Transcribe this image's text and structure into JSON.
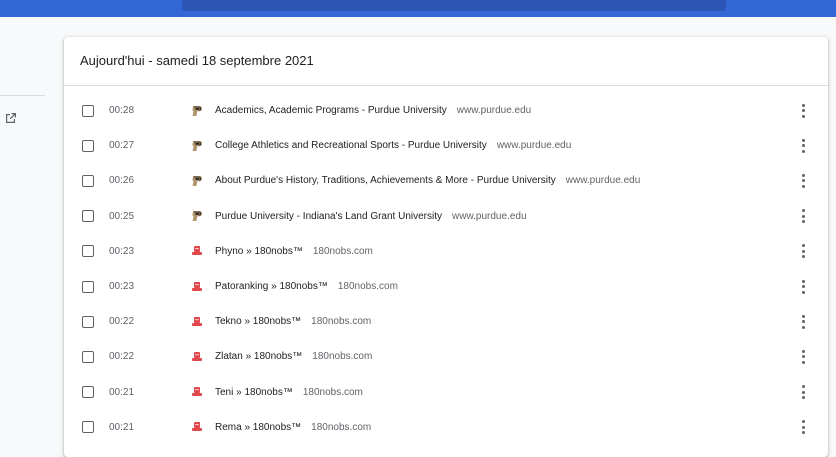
{
  "header": {
    "search_placeholder": ""
  },
  "history": {
    "date_heading": "Aujourd'hui - samedi 18 septembre 2021",
    "entries": [
      {
        "time": "00:28",
        "title": "Academics, Academic Programs - Purdue University",
        "domain": "www.purdue.edu",
        "favicon": "purdue-p-icon"
      },
      {
        "time": "00:27",
        "title": "College Athletics and Recreational Sports - Purdue University",
        "domain": "www.purdue.edu",
        "favicon": "purdue-p-icon"
      },
      {
        "time": "00:26",
        "title": "About Purdue's History, Traditions, Achievements & More - Purdue University",
        "domain": "www.purdue.edu",
        "favicon": "purdue-p-icon"
      },
      {
        "time": "00:25",
        "title": "Purdue University - Indiana's Land Grant University",
        "domain": "www.purdue.edu",
        "favicon": "purdue-p-icon"
      },
      {
        "time": "00:23",
        "title": "Phyno » 180nobs™",
        "domain": "180nobs.com",
        "favicon": "180nobs-icon"
      },
      {
        "time": "00:23",
        "title": "Patoranking » 180nobs™",
        "domain": "180nobs.com",
        "favicon": "180nobs-icon"
      },
      {
        "time": "00:22",
        "title": "Tekno » 180nobs™",
        "domain": "180nobs.com",
        "favicon": "180nobs-icon"
      },
      {
        "time": "00:22",
        "title": "Zlatan » 180nobs™",
        "domain": "180nobs.com",
        "favicon": "180nobs-icon"
      },
      {
        "time": "00:21",
        "title": "Teni » 180nobs™",
        "domain": "180nobs.com",
        "favicon": "180nobs-icon"
      },
      {
        "time": "00:21",
        "title": "Rema » 180nobs™",
        "domain": "180nobs.com",
        "favicon": "180nobs-icon"
      }
    ]
  },
  "colors": {
    "accent": "#3367d6",
    "purdue_gold": "#b1946c",
    "nobs_red": "#e0474c"
  }
}
